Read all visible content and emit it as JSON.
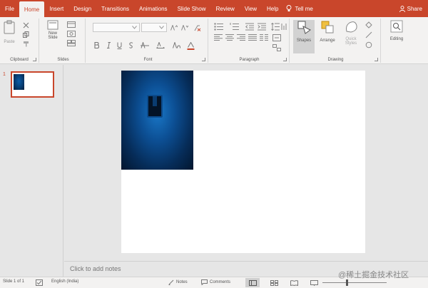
{
  "tabs": [
    {
      "label": "File",
      "active": false
    },
    {
      "label": "Home",
      "active": true
    },
    {
      "label": "Insert",
      "active": false
    },
    {
      "label": "Design",
      "active": false
    },
    {
      "label": "Transitions",
      "active": false
    },
    {
      "label": "Animations",
      "active": false
    },
    {
      "label": "Slide Show",
      "active": false
    },
    {
      "label": "Review",
      "active": false
    },
    {
      "label": "View",
      "active": false
    },
    {
      "label": "Help",
      "active": false
    }
  ],
  "tell_me": "Tell me",
  "share_label": "Share",
  "ribbon": {
    "clipboard": {
      "label": "Clipboard",
      "paste": "Paste"
    },
    "slides": {
      "label": "Slides",
      "new_slide": "New",
      "new_slide2": "Slide"
    },
    "font": {
      "label": "Font"
    },
    "paragraph": {
      "label": "Paragraph"
    },
    "drawing": {
      "label": "Drawing",
      "shapes": "Shapes",
      "arrange": "Arrange",
      "quick_styles": "Quick",
      "quick_styles2": "Styles"
    },
    "editing": {
      "label": "Editing"
    }
  },
  "thumbnail": {
    "number": "1"
  },
  "notes_placeholder": "Click to add notes",
  "status": {
    "slide_counter": "Slide 1 of 1",
    "language": "English (India)",
    "notes": "Notes",
    "comments": "Comments"
  },
  "watermark": "@稀土掘金技术社区",
  "colors": {
    "accent": "#c9462b",
    "ribbon_bg": "#f3f2f1",
    "canvas_bg": "#e6e6e6"
  }
}
